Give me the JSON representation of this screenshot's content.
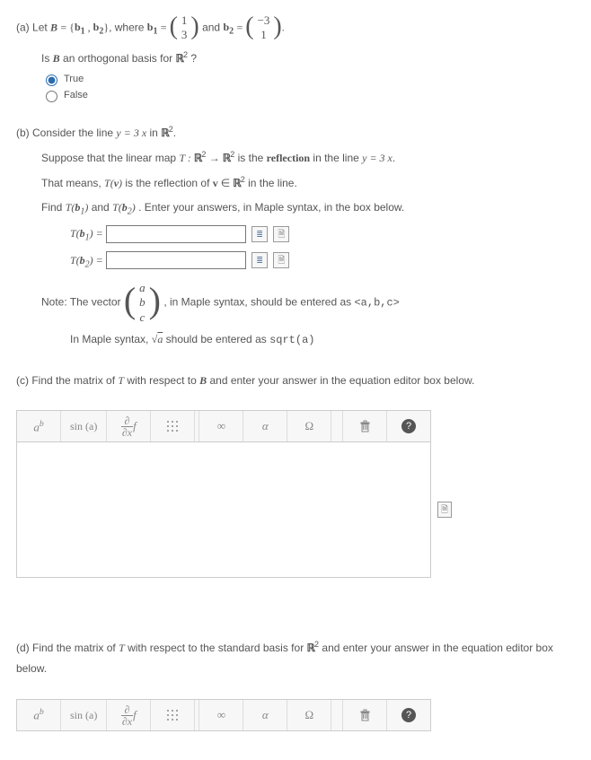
{
  "partA": {
    "label": "(a)",
    "prefix": "Let ",
    "set_lhs": "B",
    "b1": {
      "top": "1",
      "bot": "3"
    },
    "b2": {
      "top": "−3",
      "bot": "1"
    },
    "q_prefix": "Is ",
    "q_var": "B",
    "q_text": "  an orthogonal basis for ",
    "q_space": "ℝ",
    "q_exp": "2",
    "q_qmark": " ?",
    "true": "True",
    "false": "False"
  },
  "partB": {
    "label": "(b)",
    "l1_a": "Consider the line ",
    "l1_eq": "y = 3 x",
    "l1_b": " in  ",
    "l1_R": "ℝ",
    "l1_exp": "2",
    "l1_dot": ".",
    "l2_a": "Suppose that the linear map ",
    "l2_T": "T : ",
    "l2_R": "ℝ",
    "l2_exp": "2",
    "l2_arrow": " → ",
    "l2_R2": "ℝ",
    "l2_exp2": "2",
    "l2_b": " is the ",
    "l2_refl": "reflection",
    "l2_c": " in the line ",
    "l2_eq": "y = 3 x",
    "l2_dot": ".",
    "l3_a": "That means, ",
    "l3_Tv": "T(v)",
    "l3_b": " is the reflection of ",
    "l3_v": "v ∈ ",
    "l3_R": "ℝ",
    "l3_exp": "2",
    "l3_c": " in the line.",
    "l4_a": "Find ",
    "l4_Tb1": "T(b₁)",
    "l4_b": " and ",
    "l4_Tb2": "T(b₂)",
    "l4_c": ". Enter your answers, in Maple syntax, in the box below.",
    "Tb1": "T(b₁) =",
    "Tb2": "T(b₂) =",
    "note_a": "Note: The vector  ",
    "vec": {
      "a": "a",
      "b": "b",
      "c": "c"
    },
    "note_b": " , in Maple syntax, should be entered as   ",
    "note_code": "<a,b,c>",
    "note2_a": "In Maple syntax, ",
    "note2_sqrt": "√a",
    "note2_b": " should be entered as  ",
    "note2_code": "sqrt(a)"
  },
  "partC": {
    "label": "(c)",
    "text": "Find the matrix of T with respect to B and enter your answer in the equation editor box below.",
    "text_T": "T",
    "text_B": "B"
  },
  "partD": {
    "label": "(d)",
    "text_a": "Find the matrix of ",
    "text_T": "T",
    "text_b": " with respect to the standard basis for ",
    "text_R": "ℝ",
    "text_exp": "2",
    "text_c": " and enter your answer in the equation editor box below."
  },
  "toolbar": {
    "ab": "a",
    "ab_sup": "b",
    "sin": "sin (a)",
    "frac_num": "∂",
    "frac_den": "∂x",
    "frac_f": " f",
    "inf": "∞",
    "alpha": "α",
    "omega": "Ω"
  }
}
